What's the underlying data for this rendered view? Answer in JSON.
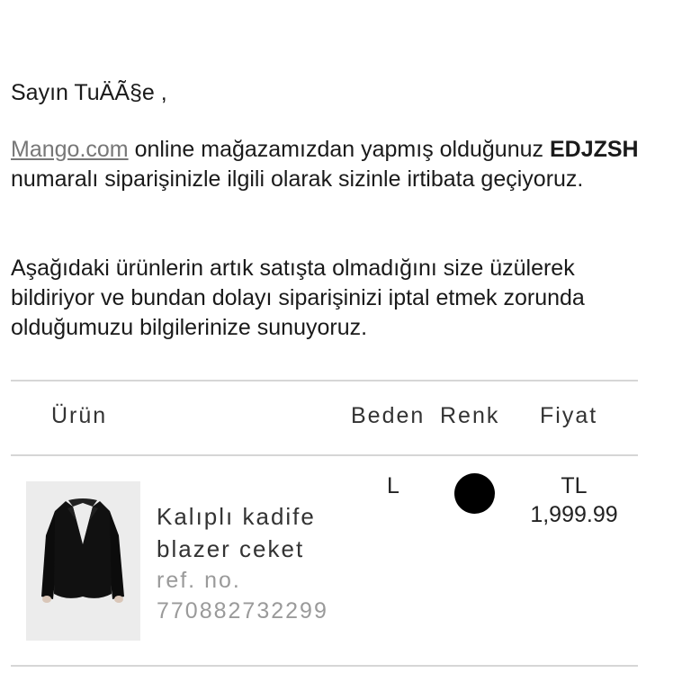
{
  "email": {
    "greeting": "Sayın TuÄÃ§e ,",
    "intro": {
      "link_text": "Mango.com",
      "text_before_code": " online mağazamızdan yapmış olduğunuz ",
      "order_code": "EDJZSH",
      "text_after_code": " numaralı siparişinizle ilgili olarak sizinle irtibata geçiyoruz."
    },
    "notice": "Aşağıdaki ürünlerin artık satışta olmadığını size üzülerek bildiriyor ve bundan dolayı siparişinizi iptal etmek zorunda olduğumuzu bilgilerinize sunuyoruz."
  },
  "table": {
    "headers": {
      "product": "Ürün",
      "size": "Beden",
      "color": "Renk",
      "price": "Fiyat"
    },
    "items": [
      {
        "name": "Kalıplı kadife blazer ceket",
        "ref_label": "ref. no.",
        "ref_number": "770882732299",
        "size": "L",
        "color_hex": "#000000",
        "currency": "TL",
        "price": "1,999.99",
        "image_icon": "black-blazer-image"
      }
    ]
  },
  "colors": {
    "link": "#777777",
    "divider": "#d6d6d6",
    "thumb_bg": "#ececec"
  }
}
